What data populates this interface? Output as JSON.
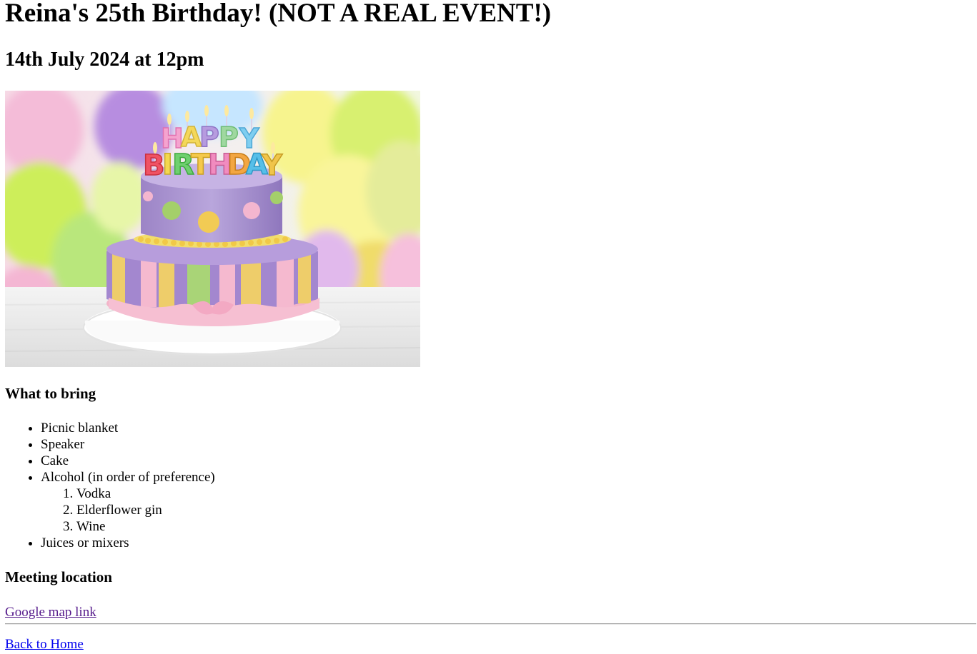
{
  "event": {
    "title": "Reina's 25th Birthday! (NOT A REAL EVENT!)",
    "datetime": "14th July 2024 at 12pm",
    "image_text": "HAPPY BIRTHDAY"
  },
  "bring": {
    "heading": "What to bring",
    "items": [
      "Picnic blanket",
      "Speaker",
      "Cake",
      "Alcohol (in order of preference)",
      "Juices or mixers"
    ],
    "alcohol": [
      "Vodka",
      "Elderflower gin",
      "Wine"
    ]
  },
  "location": {
    "heading": "Meeting location",
    "map_link": "Google map link"
  },
  "footer": {
    "home_link": "Back to Home"
  },
  "colors": {
    "visited_link": "#551a8b",
    "link": "#0000ee"
  }
}
